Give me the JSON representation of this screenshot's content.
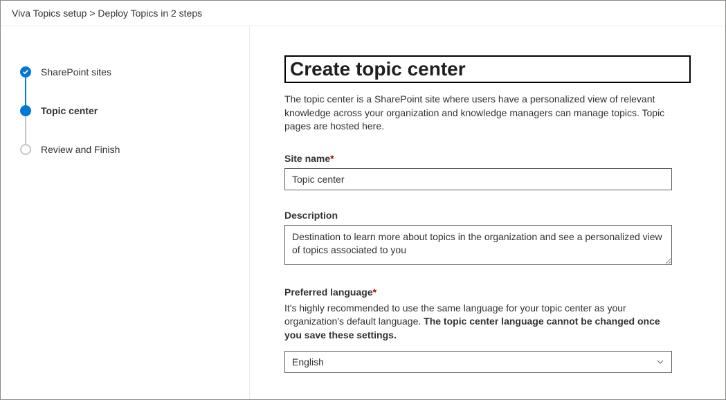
{
  "breadcrumb": {
    "parent": "Viva Topics setup",
    "separator": ">",
    "current": "Deploy Topics in 2 steps"
  },
  "steps": [
    {
      "label": "SharePoint sites",
      "state": "done"
    },
    {
      "label": "Topic center",
      "state": "current"
    },
    {
      "label": "Review and Finish",
      "state": "pending"
    }
  ],
  "page": {
    "title": "Create topic center",
    "description": "The topic center is a SharePoint site where users have a personalized view of relevant knowledge across your organization and knowledge managers can manage topics. Topic pages are hosted here."
  },
  "fields": {
    "siteName": {
      "label": "Site name",
      "required": true,
      "value": "Topic center"
    },
    "description": {
      "label": "Description",
      "required": false,
      "value": "Destination to learn more about topics in the organization and see a personalized view of topics associated to you"
    },
    "language": {
      "label": "Preferred language",
      "required": true,
      "help_prefix": "It's highly recommended to use the same language for your topic center as your organization's default language. ",
      "help_bold": "The topic center language cannot be changed once you save these settings.",
      "value": "English"
    }
  },
  "required_marker": "*"
}
